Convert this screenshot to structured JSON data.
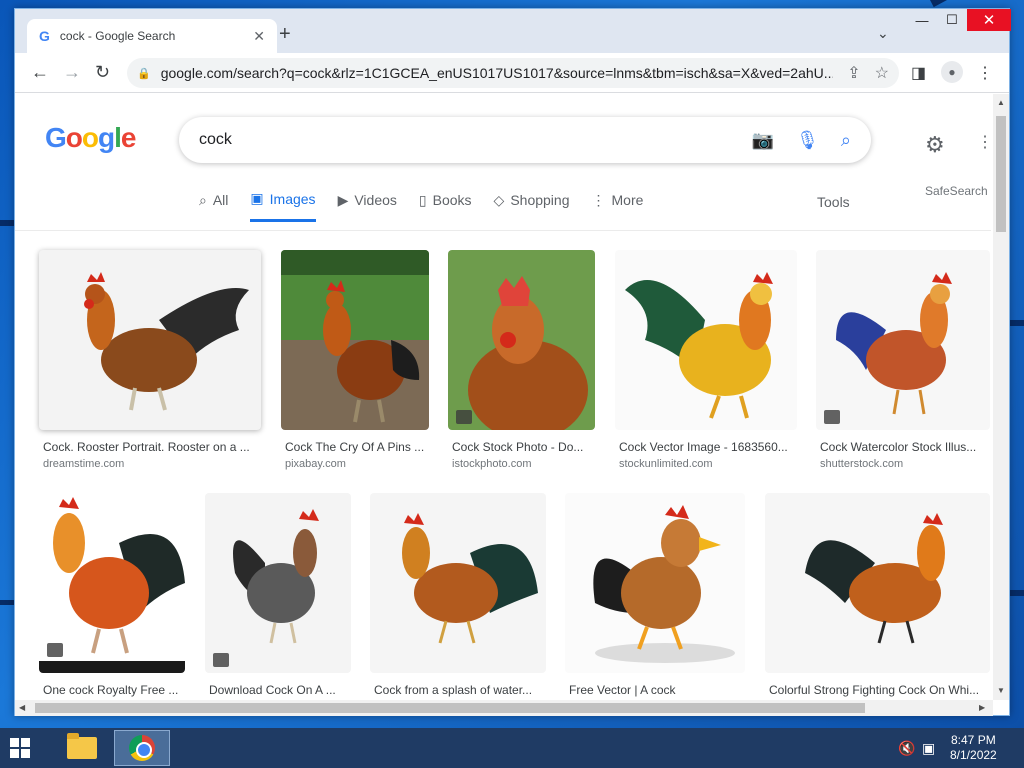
{
  "browser": {
    "tab_title": "cock - Google Search",
    "url": "google.com/search?q=cock&rlz=1C1GCEA_enUS1017US1017&source=lnms&tbm=isch&sa=X&ved=2ahU..."
  },
  "search": {
    "logo": "Google",
    "query": "cock",
    "safesearch": "SafeSearch"
  },
  "nav": {
    "items": [
      {
        "label": "All",
        "icon": "search-icon"
      },
      {
        "label": "Images",
        "icon": "image-icon",
        "active": true
      },
      {
        "label": "Videos",
        "icon": "play-icon"
      },
      {
        "label": "Books",
        "icon": "book-icon"
      },
      {
        "label": "Shopping",
        "icon": "tag-icon"
      },
      {
        "label": "More",
        "icon": "more-vert-icon"
      }
    ],
    "tools": "Tools"
  },
  "results_row1": [
    {
      "title": "Cock. Rooster Portrait. Rooster on a ...",
      "source": "dreamstime.com"
    },
    {
      "title": "Cock The Cry Of A Pins ...",
      "source": "pixabay.com"
    },
    {
      "title": "Cock Stock Photo - Do...",
      "source": "istockphoto.com"
    },
    {
      "title": "Cock Vector Image - 1683560...",
      "source": "stockunlimited.com"
    },
    {
      "title": "Cock Watercolor Stock Illus...",
      "source": "shutterstock.com"
    }
  ],
  "results_row2": [
    {
      "title": "One cock Royalty Free ..."
    },
    {
      "title": "Download Cock On A ..."
    },
    {
      "title": "Cock from a splash of water..."
    },
    {
      "title": "Free Vector | A cock"
    },
    {
      "title": "Colorful Strong Fighting Cock On Whi..."
    }
  ],
  "taskbar": {
    "time": "8:47 PM",
    "date": "8/1/2022"
  },
  "colors": {
    "accent": "#1a73e8",
    "close_button": "#e81123",
    "taskbar": "#1f3b64"
  }
}
